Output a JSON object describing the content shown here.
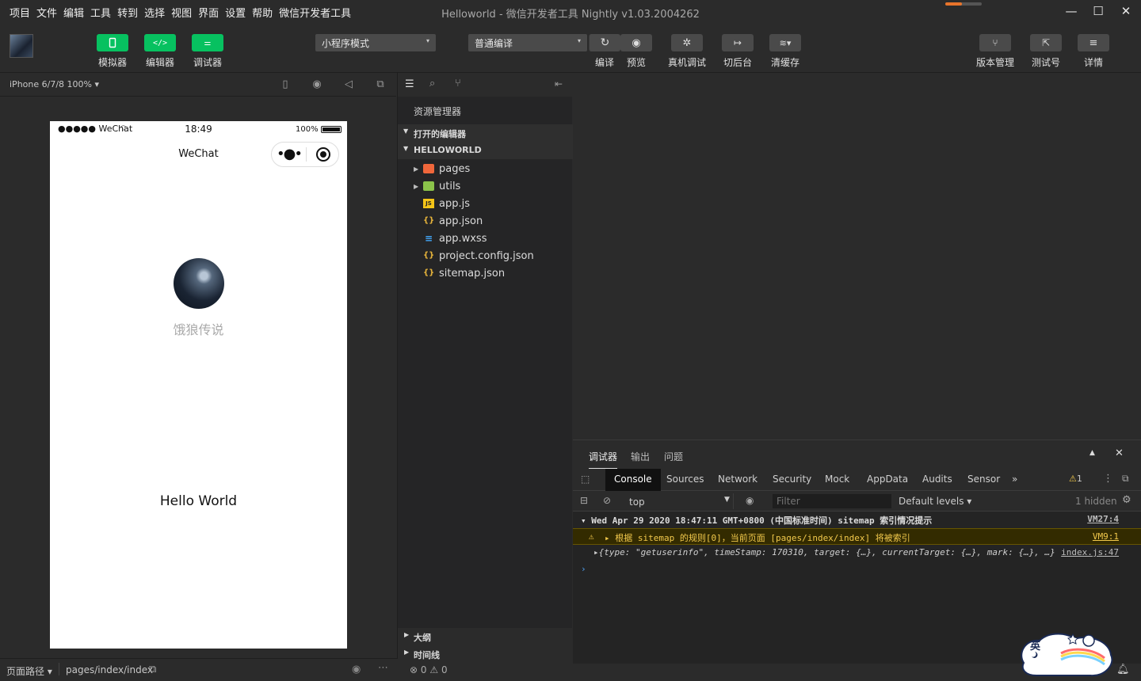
{
  "menubar": {
    "items": [
      "项目",
      "文件",
      "编辑",
      "工具",
      "转到",
      "选择",
      "视图",
      "界面",
      "设置",
      "帮助",
      "微信开发者工具"
    ],
    "title": "Helloworld - 微信开发者工具 Nightly v1.03.2004262"
  },
  "window_controls": {
    "minimize": "—",
    "maximize": "☐",
    "close": "✕"
  },
  "toolbar": {
    "simulator_label": "模拟器",
    "editor_label": "编辑器",
    "debugger_label": "调试器",
    "mode_select": "小程序模式",
    "compile_select": "普通编译",
    "compile_label": "编译",
    "preview_label": "预览",
    "remote_debug_label": "真机调试",
    "background_label": "切后台",
    "clear_cache_label": "清缓存",
    "version_label": "版本管理",
    "test_label": "测试号",
    "details_label": "详情"
  },
  "simulator": {
    "device": "iPhone 6/7/8 100% ▾",
    "status_carrier": "●●●●● WeChat",
    "status_time": "18:49",
    "status_battery": "100%",
    "nav_title": "WeChat",
    "nickname": "饿狼传说",
    "hello": "Hello World"
  },
  "footer": {
    "page_path_label": "页面路径 ▾",
    "page_path": "pages/index/index",
    "errors": "0",
    "warnings": "0"
  },
  "explorer": {
    "title": "资源管理器",
    "open_editors": "打开的编辑器",
    "project": "HELLOWORLD",
    "items": [
      {
        "name": "pages",
        "type": "folder",
        "icon": "folder-pages-icon",
        "color": "#f0673b"
      },
      {
        "name": "utils",
        "type": "folder",
        "icon": "folder-utils-icon",
        "color": "#8bc34a"
      },
      {
        "name": "app.js",
        "type": "js",
        "icon": "js-file-icon",
        "color": "#f5c518"
      },
      {
        "name": "app.json",
        "type": "json",
        "icon": "json-file-icon",
        "color": "#e8b53b"
      },
      {
        "name": "app.wxss",
        "type": "css",
        "icon": "css-file-icon",
        "color": "#42a5f5"
      },
      {
        "name": "project.config.json",
        "type": "json",
        "icon": "json-file-icon",
        "color": "#e8b53b"
      },
      {
        "name": "sitemap.json",
        "type": "json",
        "icon": "json-file-icon",
        "color": "#e8b53b"
      }
    ],
    "outline": "大纲",
    "timeline": "时间线"
  },
  "debugger": {
    "tabs": [
      "调试器",
      "输出",
      "问题"
    ],
    "devtools_tabs": [
      "Console",
      "Sources",
      "Network",
      "Security",
      "Mock",
      "AppData",
      "Audits",
      "Sensor",
      "»"
    ],
    "warning_count": "1",
    "context": "top",
    "filter_placeholder": "Filter",
    "levels": "Default levels ▾",
    "hidden": "1 hidden",
    "logs": [
      {
        "text": "▾ Wed Apr 29 2020 18:47:11 GMT+0800 (中国标准时间) sitemap 索引情况提示",
        "src": "VM27:4",
        "kind": "group"
      },
      {
        "text": "▸ 根据 sitemap 的规则[0]，当前页面 [pages/index/index] 将被索引",
        "src": "VM9:1",
        "kind": "warn"
      },
      {
        "text": "▸{type: \"getuserinfo\", timeStamp: 170310, target: {…}, currentTarget: {…}, mark: {…}, …}",
        "src": "index.js:47",
        "kind": "obj"
      }
    ],
    "prompt": "›"
  },
  "mascot": {
    "text": "英"
  },
  "colors": {
    "green": "#07c160",
    "warn_bg": "#332b00",
    "warn_text": "#f2c94c",
    "accent": "#e8742b"
  }
}
